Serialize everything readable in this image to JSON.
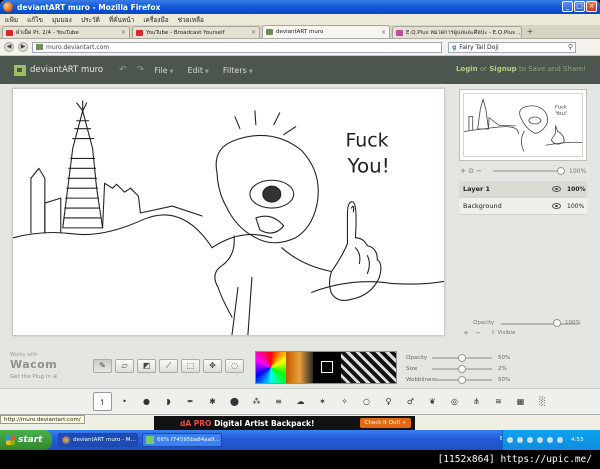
{
  "window": {
    "title": "deviantART muro - Mozilla Firefox"
  },
  "menu": [
    "แฟ้ม",
    "แก้ไข",
    "มุมมอง",
    "ประวัติ",
    "ที่คั่นหน้า",
    "เครื่องมือ",
    "ช่วยเหลือ"
  ],
  "tabs": [
    {
      "label": "ฝ่าเม็ด Pt. 2/4 - YouTube",
      "fav_color": "#d62a1e"
    },
    {
      "label": "YouTube - Broadcast Yourself",
      "fav_color": "#d62a1e"
    },
    {
      "label": "deviantART muro",
      "fav_color": "#6f8d54"
    },
    {
      "label": "E.Q.Plus หมวดการดูแลและศิลปะ - E.Q.Plus ...",
      "fav_color": "#c44a9b"
    }
  ],
  "nav": {
    "url": "muro.deviantart.com",
    "search": "Fairy Tail Doji"
  },
  "muro": {
    "logo": "deviantART muro",
    "menus": [
      "File",
      "Edit",
      "Filters"
    ],
    "login": "Login",
    "or": "or",
    "signup": "Signup",
    "to_save": "to Save and Share!"
  },
  "zoom": {
    "value": "100%"
  },
  "layers": [
    {
      "name": "Layer 1",
      "opacity": "100%"
    },
    {
      "name": "Background",
      "opacity": "100%"
    }
  ],
  "layer_opacity": {
    "label": "Opacity",
    "value": "100%",
    "visible_label": "Visible"
  },
  "brand": {
    "works_with": "Works with",
    "wacom": "Wacom",
    "plug": "Get the Plug In"
  },
  "brush_settings": [
    {
      "name": "Opacity",
      "value": "50%",
      "level": 0.5
    },
    {
      "name": "Size",
      "value": "2%",
      "level": 0.5
    },
    {
      "name": "Wobbliness",
      "value": "50%",
      "level": 0.5
    }
  ],
  "drawing": {
    "text_line1": "Fuck",
    "text_line2": "You!"
  },
  "status": {
    "url": "http://muro.deviantart.com/"
  },
  "ad": {
    "prefix": "dA PRO",
    "text": "Digital Artist Backpack!",
    "button": "Check It Out! »"
  },
  "taskbar": {
    "start": "start",
    "tasks": [
      "deviantART muro - M...",
      "66% f74595ba84aa9..."
    ],
    "lang": "EN",
    "time": "4:53"
  },
  "watermark": "[1152x864] https://upic.me/"
}
